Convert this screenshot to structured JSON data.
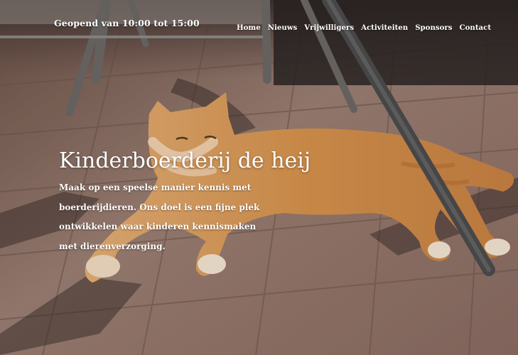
{
  "header": {
    "hours": "Geopend van 10:00 tot 15:00",
    "nav": [
      {
        "label": "Home"
      },
      {
        "label": "Nieuws"
      },
      {
        "label": "Vrijwilligers"
      },
      {
        "label": "Activiteiten"
      },
      {
        "label": "Sponsors"
      },
      {
        "label": "Contact"
      }
    ]
  },
  "hero": {
    "title": "Kinderboerderij de heij",
    "intro": "Maak op een speelse manier kennis met boerderijdieren. Ons doel is een fijne plek ontwikkelen waar kinderen kennismaken met dierenverzorging."
  },
  "colors": {
    "paving": "#9a7e73",
    "cat_fur": "#d8934a",
    "text": "#ffffff"
  }
}
